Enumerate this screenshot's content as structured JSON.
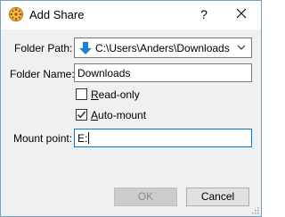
{
  "window": {
    "title": "Add Share",
    "help_glyph": "?",
    "close_glyph": "✕"
  },
  "form": {
    "folder_path": {
      "label": "Folder Path:",
      "value": "C:\\Users\\Anders\\Downloads",
      "icon": "down-arrow-icon"
    },
    "folder_name": {
      "label": "Folder Name:",
      "value": "Downloads"
    },
    "read_only": {
      "label_first": "R",
      "label_rest": "ead-only",
      "checked": false
    },
    "auto_mount": {
      "label_first": "A",
      "label_rest": "uto-mount",
      "checked": true
    },
    "mount_point": {
      "label": "Mount point:",
      "value": "E:"
    }
  },
  "buttons": {
    "ok_label": "OK",
    "ok_enabled": false,
    "cancel_label": "Cancel"
  },
  "colors": {
    "accent_arrow": "#1e7fd8",
    "dialog_bg": "#f0f0f0"
  }
}
